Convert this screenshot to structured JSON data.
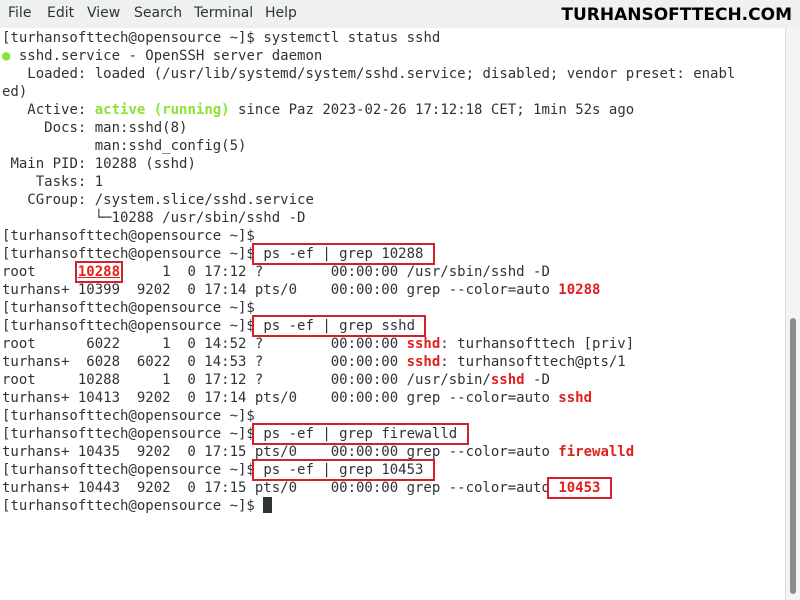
{
  "menu": {
    "items": [
      "File",
      "Edit",
      "View",
      "Search",
      "Terminal",
      "Help"
    ]
  },
  "watermark": "TURHANSOFTTECH.COM",
  "prompt": "[turhansofttech@opensource ~]$",
  "status": {
    "command": "systemctl status sshd",
    "unit_line": "sshd.service - OpenSSH server daemon",
    "loaded_label": "Loaded:",
    "loaded_value": "loaded (/usr/lib/systemd/system/sshd.service; disabled; vendor preset: enabl",
    "loaded_wrap": "ed)",
    "active_label": "Active:",
    "active_state": "active (running)",
    "active_since": "since Paz 2023-02-26 17:12:18 CET; 1min 52s ago",
    "docs_label": "Docs:",
    "docs_1": "man:sshd(8)",
    "docs_2": "man:sshd_config(5)",
    "pid_label": "Main PID:",
    "pid_value": "10288 (sshd)",
    "tasks_label": "Tasks:",
    "tasks_value": "1",
    "cgroup_label": "CGroup:",
    "cgroup_value": "/system.slice/sshd.service",
    "cgroup_child": "└─10288 /usr/sbin/sshd -D"
  },
  "cmd1": {
    "command": "ps -ef | grep 10288",
    "row1_a": "root     ",
    "row1_pid": "10288",
    "row1_b": "     1  0 17:12 ?        00:00:00 /usr/sbin/sshd -D",
    "row2_a": "turhans+ 10399  9202  0 17:14 pts/0    00:00:00 grep --color=auto ",
    "row2_match": "10288"
  },
  "cmd2": {
    "command": "ps -ef | grep sshd",
    "row1_a": "root      6022     1  0 14:52 ?        00:00:00 ",
    "row1_match": "sshd",
    "row1_b": ": turhansofttech [priv]",
    "row2_a": "turhans+  6028  6022  0 14:53 ?        00:00:00 ",
    "row2_match": "sshd",
    "row2_b": ": turhansofttech@pts/1",
    "row3_a": "root     10288     1  0 17:12 ?        00:00:00 /usr/sbin/",
    "row3_match": "sshd",
    "row3_b": " -D",
    "row4_a": "turhans+ 10413  9202  0 17:14 pts/0    00:00:00 grep --color=auto ",
    "row4_match": "sshd"
  },
  "cmd3": {
    "command": "ps -ef | grep firewalld",
    "row1_a": "turhans+ 10435  9202  0 17:15 pts/0    00:00:00 grep --color=auto ",
    "row1_match": "firewalld"
  },
  "cmd4": {
    "command": "ps -ef | grep 10453",
    "row1_a": "turhans+ 10443  9202  0 17:15 pts/0    00:00:00 grep --color=auto",
    "row1_match": "10453"
  },
  "colors": {
    "highlight_box": "#d3202a",
    "match_red": "#e0201d",
    "status_green": "#8ae234"
  }
}
